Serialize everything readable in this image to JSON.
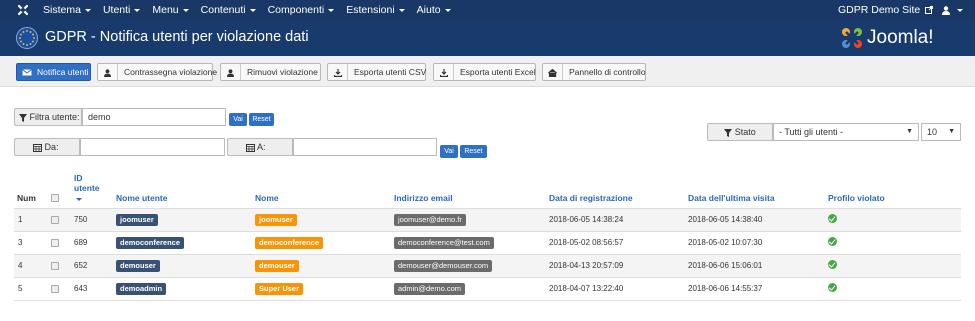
{
  "topbar": {
    "menu": [
      "Sistema",
      "Utenti",
      "Menu",
      "Contenuti",
      "Componenti",
      "Estensioni",
      "Aiuto"
    ],
    "site_name": "GDPR Demo Site"
  },
  "header": {
    "title": "GDPR - Notifica utenti per violazione dati",
    "brand": "Joomla!"
  },
  "toolbar": {
    "buttons": [
      "Notifica utenti",
      "Contrassegna violazione",
      "Rimuovi violazione",
      "Esporta utenti CSV",
      "Esporta utenti Excel",
      "Pannello di controllo"
    ]
  },
  "filters": {
    "user_label": "Filtra utente:",
    "user_value": "demo",
    "go": "Vai",
    "reset": "Reset",
    "from_label": "Da:",
    "to_label": "A:",
    "state_label": "Stato",
    "state_value": "- Tutti gli utenti -",
    "limit_value": "10"
  },
  "table": {
    "headers": {
      "num": "Num",
      "id": "ID utente",
      "username": "Nome utente",
      "name": "Nome",
      "email": "Indirizzo email",
      "registered": "Data di registrazione",
      "last_visit": "Data dell'ultima visita",
      "violated": "Profilo violato"
    },
    "rows": [
      {
        "num": "1",
        "id": "750",
        "username": "joomuser",
        "name": "joomuser",
        "email": "joomuser@demo.fr",
        "registered": "2018-06-05 14:38:24",
        "last_visit": "2018-06-05 14:38:40"
      },
      {
        "num": "3",
        "id": "689",
        "username": "democonference",
        "name": "democonference",
        "email": "democonference@test.com",
        "registered": "2018-05-02 08:56:57",
        "last_visit": "2018-05-02 10:07:30"
      },
      {
        "num": "4",
        "id": "652",
        "username": "demouser",
        "name": "demouser",
        "email": "demouser@demouser.com",
        "registered": "2018-04-13 20:57:09",
        "last_visit": "2018-06-06 15:06:01"
      },
      {
        "num": "5",
        "id": "643",
        "username": "demoadmin",
        "name": "Super User",
        "email": "admin@demo.com",
        "registered": "2018-04-07 13:22:40",
        "last_visit": "2018-06-06 14:55:37"
      }
    ]
  },
  "colors": {
    "navbar": "#1a3867",
    "primary": "#2f6fc5",
    "label_dark": "#385274",
    "label_orange": "#f89406",
    "label_gray": "#6b6b6b",
    "success": "#46a546"
  }
}
